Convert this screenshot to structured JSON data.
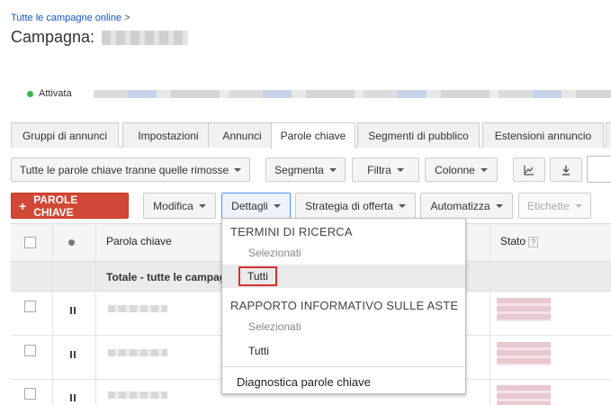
{
  "breadcrumb": {
    "link": "Tutte le campagne online",
    "separator": ">"
  },
  "page": {
    "title_prefix": "Campagna:"
  },
  "status": {
    "label": "Attivata",
    "color": "#3cb54a"
  },
  "tabs": [
    {
      "label": "Gruppi di annunci",
      "active": false
    },
    {
      "label": "Impostazioni",
      "active": false
    },
    {
      "label": "Annunci",
      "active": false
    },
    {
      "label": "Parole chiave",
      "active": true
    },
    {
      "label": "Segmenti di pubblico",
      "active": false
    },
    {
      "label": "Estensioni annuncio",
      "active": false
    }
  ],
  "toolbar1": {
    "filter_view": "Tutte le parole chiave tranne quelle rimosse",
    "segment": "Segmenta",
    "filter": "Filtra",
    "columns": "Colonne",
    "chart_icon": "line-chart-icon",
    "download_icon": "download-icon"
  },
  "toolbar2": {
    "add_keywords": "PAROLE CHIAVE",
    "add_symbol": "+",
    "edit": "Modifica",
    "details": "Dettagli",
    "bid_strategy": "Strategia di offerta",
    "automate": "Automatizza",
    "labels": "Etichette"
  },
  "table": {
    "headers": {
      "keyword": "Parola chiave",
      "status": "Stato",
      "help": "?"
    },
    "total_label": "Totale - tutte le campagne",
    "row_state_icon": "pause-icon"
  },
  "details_menu": {
    "section1": "TERMINI DI RICERCA",
    "s1_selected": "Selezionati",
    "s1_all": "Tutti",
    "section2": "RAPPORTO INFORMATIVO SULLE ASTE",
    "s2_selected": "Selezionati",
    "s2_all": "Tutti",
    "diagnostics": "Diagnostica parole chiave"
  },
  "colors": {
    "accent_red": "#d14836",
    "link_blue": "#1155cc",
    "highlight_red": "#d32f2f"
  }
}
